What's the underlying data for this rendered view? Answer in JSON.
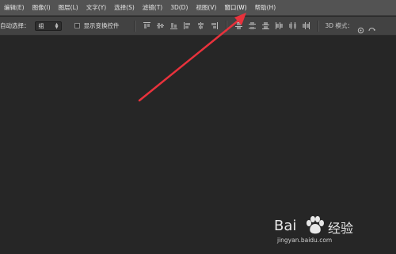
{
  "menubar": {
    "items": [
      {
        "label": "编辑(E)"
      },
      {
        "label": "图像(I)"
      },
      {
        "label": "图层(L)"
      },
      {
        "label": "文字(Y)"
      },
      {
        "label": "选择(S)"
      },
      {
        "label": "滤镜(T)"
      },
      {
        "label": "3D(D)"
      },
      {
        "label": "视图(V)"
      },
      {
        "label": "窗口(W)"
      },
      {
        "label": "帮助(H)"
      }
    ]
  },
  "options": {
    "auto_select_label": "自动选择：",
    "auto_select_value": "组",
    "show_transform_label": "显示变换控件",
    "mode_3d_label": "3D 模式：",
    "show_transform_checked": false
  },
  "watermark": {
    "brand_left": "Bai",
    "brand_right": "经验",
    "url": "jingyan.baidu.com"
  },
  "colors": {
    "menubar_bg": "#535353",
    "options_bg": "#424242",
    "canvas_bg": "#262626",
    "arrow": "#e8323c"
  }
}
